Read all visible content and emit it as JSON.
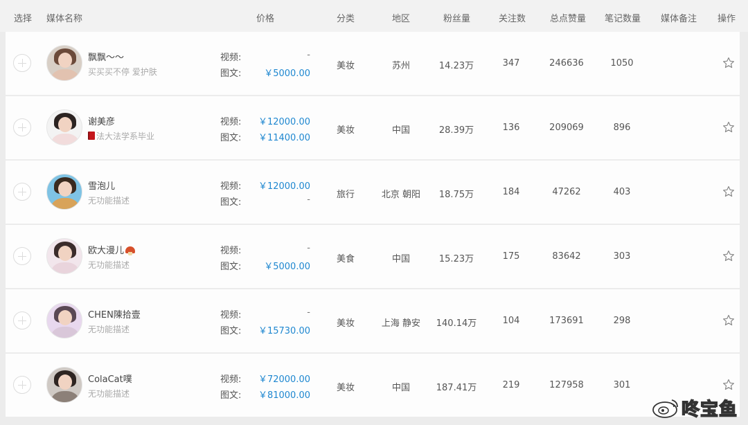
{
  "columns": {
    "select": "选择",
    "media_name": "媒体名称",
    "price": "价格",
    "category": "分类",
    "region": "地区",
    "fans": "粉丝量",
    "following": "关注数",
    "likes": "总点赞量",
    "notes": "笔记数量",
    "remark": "媒体备注",
    "action": "操作"
  },
  "price_labels": {
    "video": "视频:",
    "image_text": "图文:"
  },
  "rows": [
    {
      "name": "飘飘～～",
      "desc": "买买买不停 爱护肤",
      "video_price": "-",
      "text_price": "￥5000.00",
      "category": "美妆",
      "region": "苏州",
      "fans": "14.23万",
      "following": "347",
      "likes": "246636",
      "notes": "1050"
    },
    {
      "name": "谢美彦",
      "desc": "法大法学系毕业",
      "video_price": "￥12000.00",
      "text_price": "￥11400.00",
      "category": "美妆",
      "region": "中国",
      "fans": "28.39万",
      "following": "136",
      "likes": "209069",
      "notes": "896"
    },
    {
      "name": "雪泡儿",
      "desc": "无功能描述",
      "video_price": "￥12000.00",
      "text_price": "-",
      "category": "旅行",
      "region": "北京 朝阳",
      "fans": "18.75万",
      "following": "184",
      "likes": "47262",
      "notes": "403"
    },
    {
      "name": "欧大漫儿",
      "desc": "无功能描述",
      "video_price": "-",
      "text_price": "￥5000.00",
      "category": "美食",
      "region": "中国",
      "fans": "15.23万",
      "following": "175",
      "likes": "83642",
      "notes": "303"
    },
    {
      "name": "CHEN陳拾壹",
      "desc": "无功能描述",
      "video_price": "-",
      "text_price": "￥15730.00",
      "category": "美妆",
      "region": "上海 静安",
      "fans": "140.14万",
      "following": "104",
      "likes": "173691",
      "notes": "298"
    },
    {
      "name": "ColaCat噗",
      "desc": "无功能描述",
      "video_price": "￥72000.00",
      "text_price": "￥81000.00",
      "category": "美妆",
      "region": "中国",
      "fans": "187.41万",
      "following": "219",
      "likes": "127958",
      "notes": "301"
    }
  ],
  "watermark": {
    "text": "咚宝鱼",
    "icon": "weibo-icon"
  },
  "icons": {
    "select": "plus-circle-icon",
    "favorite": "star-outline-icon"
  },
  "colors": {
    "price": "#1e87d0",
    "header_bg": "#f2f2f2",
    "row_bg": "#fdfdfd"
  }
}
